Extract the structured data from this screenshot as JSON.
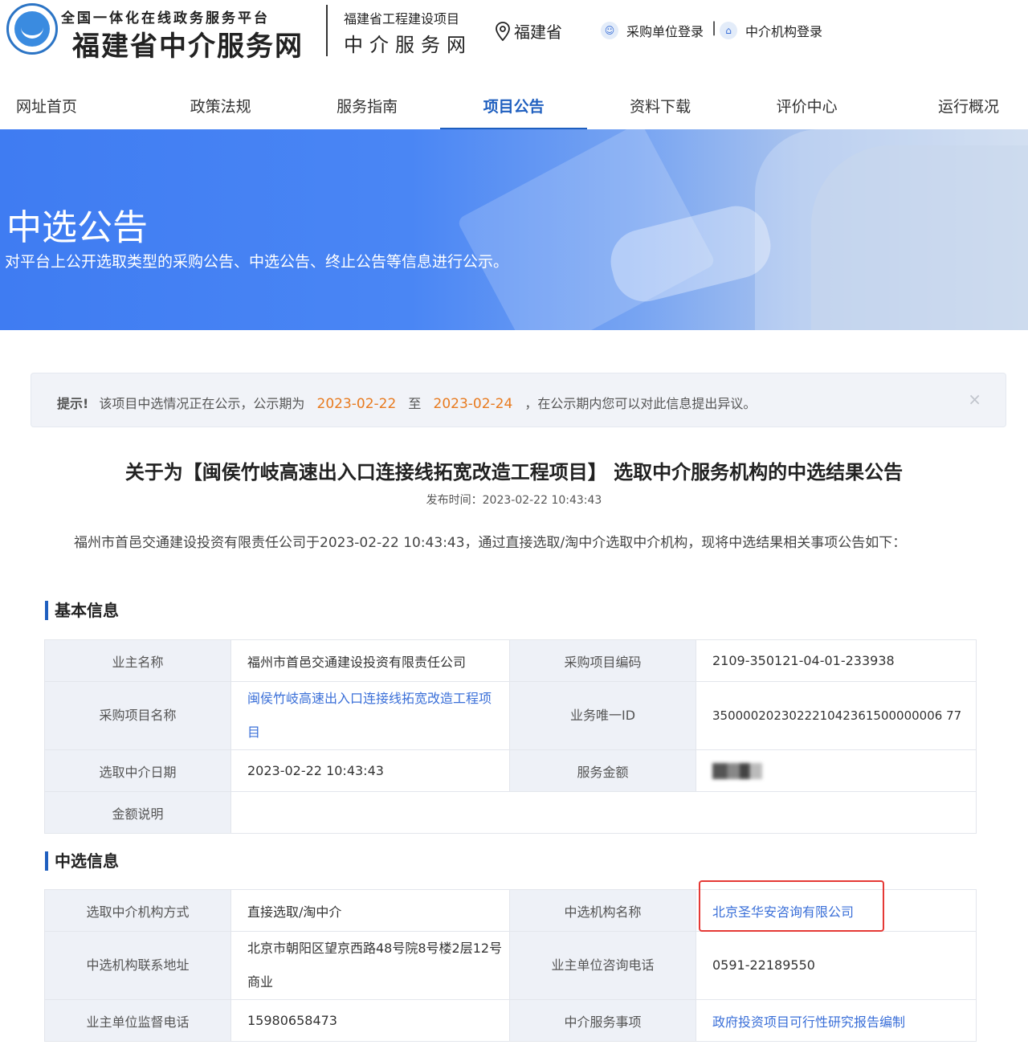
{
  "header": {
    "logo_sub": "全国一体化在线政务服务平台",
    "logo_main": "福建省中介服务网",
    "project_sub": "福建省工程建设项目",
    "project_main": "中介服务网",
    "region": "福建省",
    "login_buyer": "采购单位登录",
    "login_separator": "|",
    "login_agency": "中介机构登录"
  },
  "nav": {
    "items": [
      {
        "label": "网址首页"
      },
      {
        "label": "政策法规"
      },
      {
        "label": "服务指南"
      },
      {
        "label": "项目公告",
        "active": true
      },
      {
        "label": "资料下载"
      },
      {
        "label": "评价中心"
      },
      {
        "label": "运行概况"
      }
    ]
  },
  "banner": {
    "title": "中选公告",
    "description": "对平台上公开选取类型的采购公告、中选公告、终止公告等信息进行公示。"
  },
  "notice": {
    "label": "提示!",
    "text_before": "该项目中选情况正在公示，公示期为",
    "start_date": "2023-02-22",
    "to": "至",
    "end_date": "2023-02-24",
    "text_after": "，在公示期内您可以对此信息提出异议。",
    "close_glyph": "×"
  },
  "article": {
    "title": "关于为【闽侯竹岐高速出入口连接线拓宽改造工程项目】 选取中介服务机构的中选结果公告",
    "publish_time": "发布时间：2023-02-22 10:43:43",
    "intro": "福州市首邑交通建设投资有限责任公司于2023-02-22 10:43:43，通过直接选取/淘中介选取中介机构，现将中选结果相关事项公告如下："
  },
  "basic_info": {
    "section_title": "基本信息",
    "owner_name_label": "业主名称",
    "owner_name": "福州市首邑交通建设投资有限责任公司",
    "project_code_label": "采购项目编码",
    "project_code": "2109-350121-04-01-233938",
    "project_name_label": "采购项目名称",
    "project_name": "闽侯竹岐高速出入口连接线拓宽改造工程项目",
    "unique_id_label": "业务唯一ID",
    "unique_id": "350000202302221042361500000006 77",
    "select_date_label": "选取中介日期",
    "select_date": "2023-02-22 10:43:43",
    "amount_label": "服务金额",
    "amount_note_label": "金额说明",
    "amount_note": ""
  },
  "selection_info": {
    "section_title": "中选信息",
    "method_label": "选取中介机构方式",
    "method": "直接选取/淘中介",
    "agency_name_label": "中选机构名称",
    "agency_name": "北京圣华安咨询有限公司",
    "agency_address_label": "中选机构联系地址",
    "agency_address": "北京市朝阳区望京西路48号院8号楼2层12号商业",
    "owner_phone_label": "业主单位咨询电话",
    "owner_phone": "0591-22189550",
    "supervise_phone_label": "业主单位监督电话",
    "supervise_phone": "15980658473",
    "service_item_label": "中介服务事项",
    "service_item": "政府投资项目可行性研究报告编制"
  }
}
